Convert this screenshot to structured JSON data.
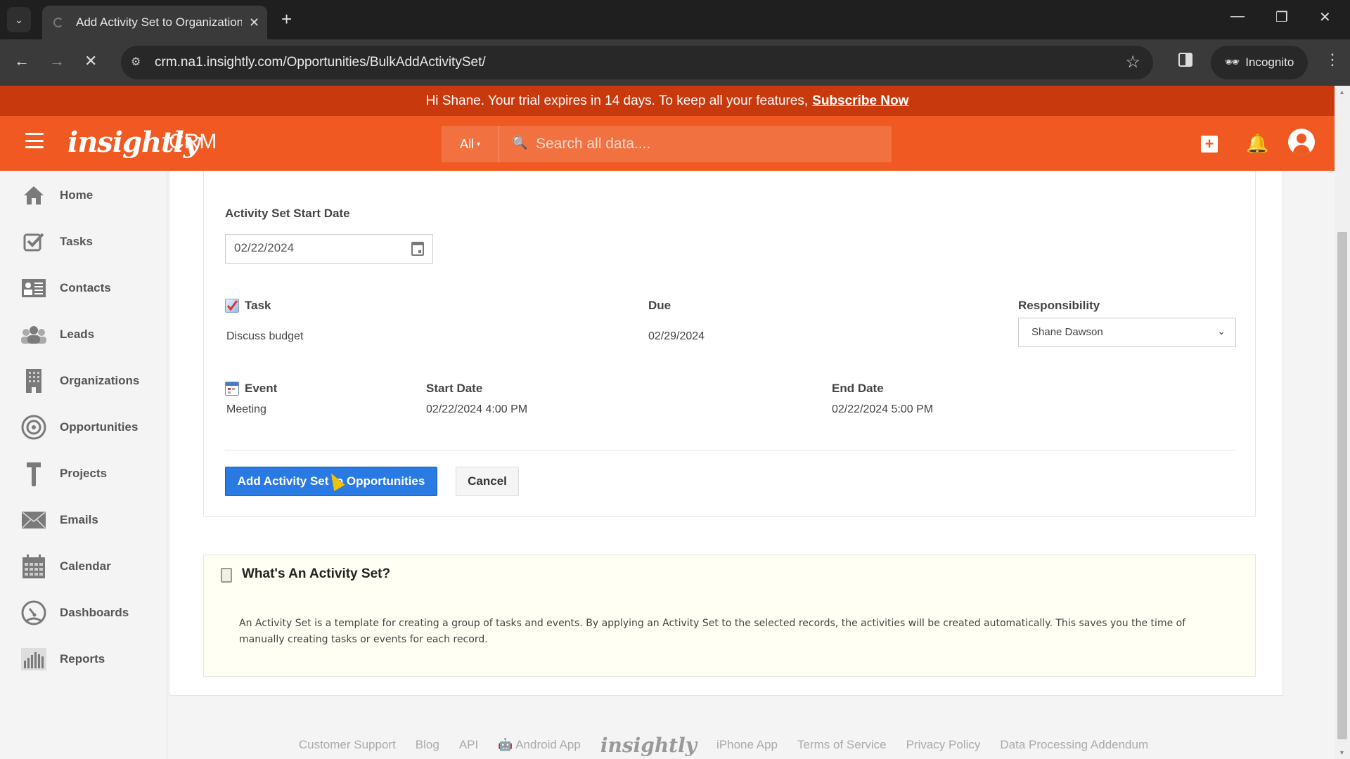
{
  "browser": {
    "tab_title": "Add Activity Set to Organizations",
    "url": "crm.na1.insightly.com/Opportunities/BulkAddActivitySet/",
    "incognito_label": "Incognito"
  },
  "trial_banner": {
    "message": "Hi Shane. Your trial expires in 14 days. To keep all your features,",
    "link": "Subscribe Now"
  },
  "header": {
    "logo": "insightly",
    "product": "CRM",
    "search_scope": "All",
    "search_placeholder": "Search all data...."
  },
  "sidebar": {
    "items": [
      {
        "label": "Home",
        "icon": "home-icon"
      },
      {
        "label": "Tasks",
        "icon": "tasks-icon"
      },
      {
        "label": "Contacts",
        "icon": "contacts-icon"
      },
      {
        "label": "Leads",
        "icon": "leads-icon"
      },
      {
        "label": "Organizations",
        "icon": "organizations-icon"
      },
      {
        "label": "Opportunities",
        "icon": "opportunities-icon"
      },
      {
        "label": "Projects",
        "icon": "projects-icon"
      },
      {
        "label": "Emails",
        "icon": "emails-icon"
      },
      {
        "label": "Calendar",
        "icon": "calendar-icon"
      },
      {
        "label": "Dashboards",
        "icon": "dashboards-icon"
      },
      {
        "label": "Reports",
        "icon": "reports-icon"
      }
    ]
  },
  "form": {
    "start_date_label": "Activity Set Start Date",
    "start_date_value": "02/22/2024",
    "task": {
      "header": "Task",
      "due_header": "Due",
      "responsibility_header": "Responsibility",
      "name": "Discuss budget",
      "due": "02/29/2024",
      "responsibility": "Shane Dawson"
    },
    "event": {
      "header": "Event",
      "start_header": "Start Date",
      "end_header": "End Date",
      "name": "Meeting",
      "start": "02/22/2024 4:00 PM",
      "end": "02/22/2024 5:00 PM"
    },
    "submit_label": "Add Activity Set to Opportunities",
    "cancel_label": "Cancel"
  },
  "help": {
    "title": "What's An Activity Set?",
    "body": "An Activity Set is a template for creating a group of tasks and events. By applying an Activity Set to the selected records, the activities will be created automatically. This saves you the time of manually creating tasks or events for each record."
  },
  "footer": {
    "links": [
      "Customer Support",
      "Blog",
      "API",
      "Android App",
      "iPhone App",
      "Terms of Service",
      "Privacy Policy",
      "Data Processing Addendum"
    ],
    "logo": "insightly"
  },
  "colors": {
    "brand_orange": "#f05a22",
    "banner_red": "#c9390e",
    "primary_button": "#2a7ae4"
  }
}
